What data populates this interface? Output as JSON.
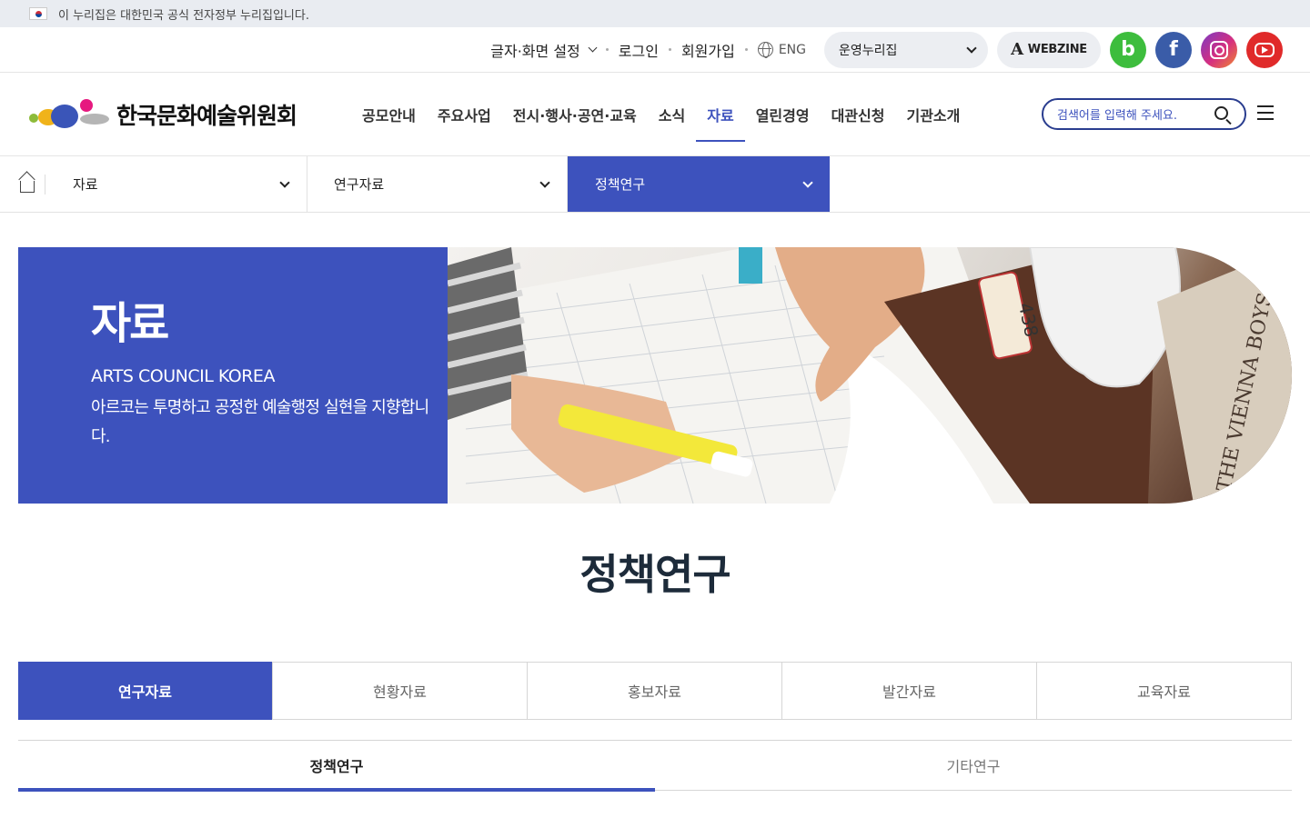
{
  "gov_banner": {
    "text": "이 누리집은 대한민국 공식 전자정부 누리집입니다.",
    "icon": "flag-icon"
  },
  "utility": {
    "font_setting": "글자·화면 설정",
    "login": "로그인",
    "signup": "회원가입",
    "lang": "ENG",
    "site_select": "운영누리집",
    "webzine": "WEBZINE",
    "webzine_mark": "A",
    "blog_mark": "b",
    "fb_mark": "f"
  },
  "header": {
    "logo_text": "한국문화예술위원회",
    "nav": [
      {
        "label": "공모안내"
      },
      {
        "label": "주요사업"
      },
      {
        "label": "전시·행사·공연·교육"
      },
      {
        "label": "소식"
      },
      {
        "label": "자료",
        "active": true
      },
      {
        "label": "열린경영"
      },
      {
        "label": "대관신청"
      },
      {
        "label": "기관소개"
      }
    ],
    "search_placeholder": "검색어를 입력해 주세요."
  },
  "location": {
    "depth1": "자료",
    "depth2": "연구자료",
    "depth3": "정책연구"
  },
  "hero": {
    "title": "자료",
    "subtitle": "ARTS COUNCIL KOREA",
    "description": "아르코는 투명하고 공정한 예술행정 실현을 지향합니다.",
    "label_number": "438",
    "book_text": "THE VIENNA BOYS"
  },
  "page_title": "정책연구",
  "tabs": [
    {
      "label": "연구자료",
      "active": true
    },
    {
      "label": "현황자료"
    },
    {
      "label": "홍보자료"
    },
    {
      "label": "발간자료"
    },
    {
      "label": "교육자료"
    }
  ],
  "subtabs": [
    {
      "label": "정책연구",
      "active": true
    },
    {
      "label": "기타연구"
    }
  ],
  "colors": {
    "primary": "#3d52bd",
    "nav_active": "#3d52bd"
  }
}
